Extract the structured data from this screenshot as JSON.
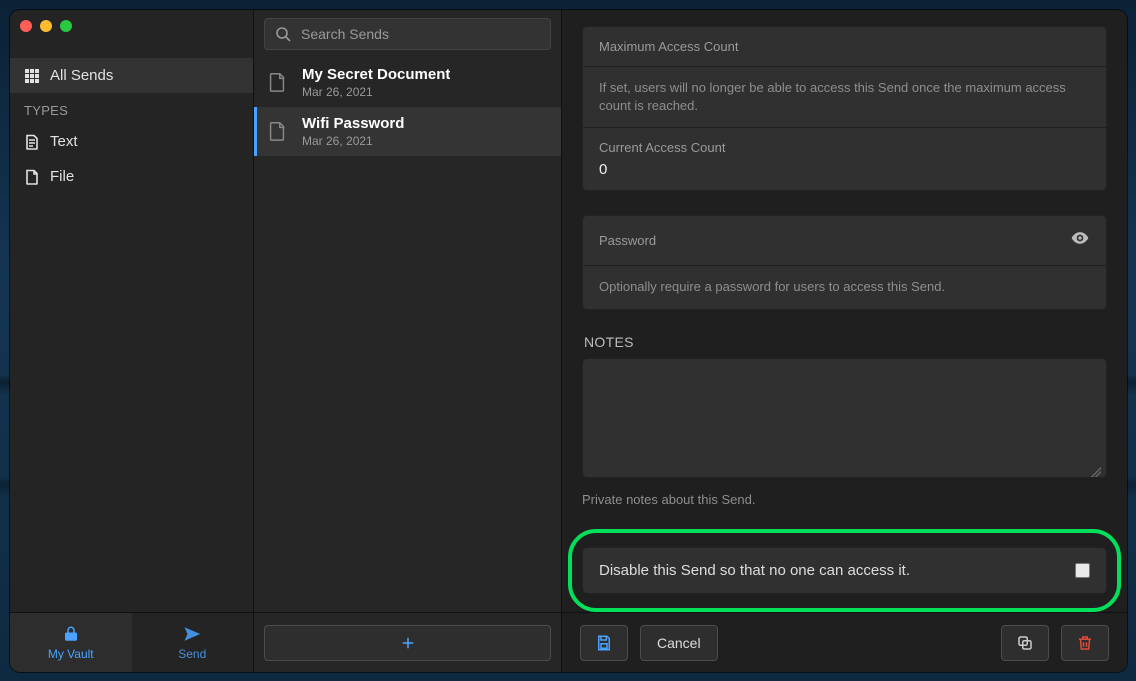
{
  "search": {
    "placeholder": "Search Sends"
  },
  "sidebar": {
    "allSends": "All Sends",
    "typesHeader": "TYPES",
    "types": [
      {
        "label": "Text"
      },
      {
        "label": "File"
      }
    ]
  },
  "bottomTabs": {
    "vault": "My Vault",
    "send": "Send"
  },
  "list": [
    {
      "title": "My Secret Document",
      "date": "Mar 26, 2021"
    },
    {
      "title": "Wifi Password",
      "date": "Mar 26, 2021"
    }
  ],
  "detail": {
    "maxAccess": {
      "label": "Maximum Access Count",
      "help": "If set, users will no longer be able to access this Send once the maximum access count is reached."
    },
    "currentAccess": {
      "label": "Current Access Count",
      "value": "0"
    },
    "password": {
      "label": "Password",
      "help": "Optionally require a password for users to access this Send."
    },
    "notes": {
      "heading": "NOTES",
      "help": "Private notes about this Send."
    },
    "disable": {
      "label": "Disable this Send so that no one can access it."
    }
  },
  "actions": {
    "cancel": "Cancel"
  }
}
